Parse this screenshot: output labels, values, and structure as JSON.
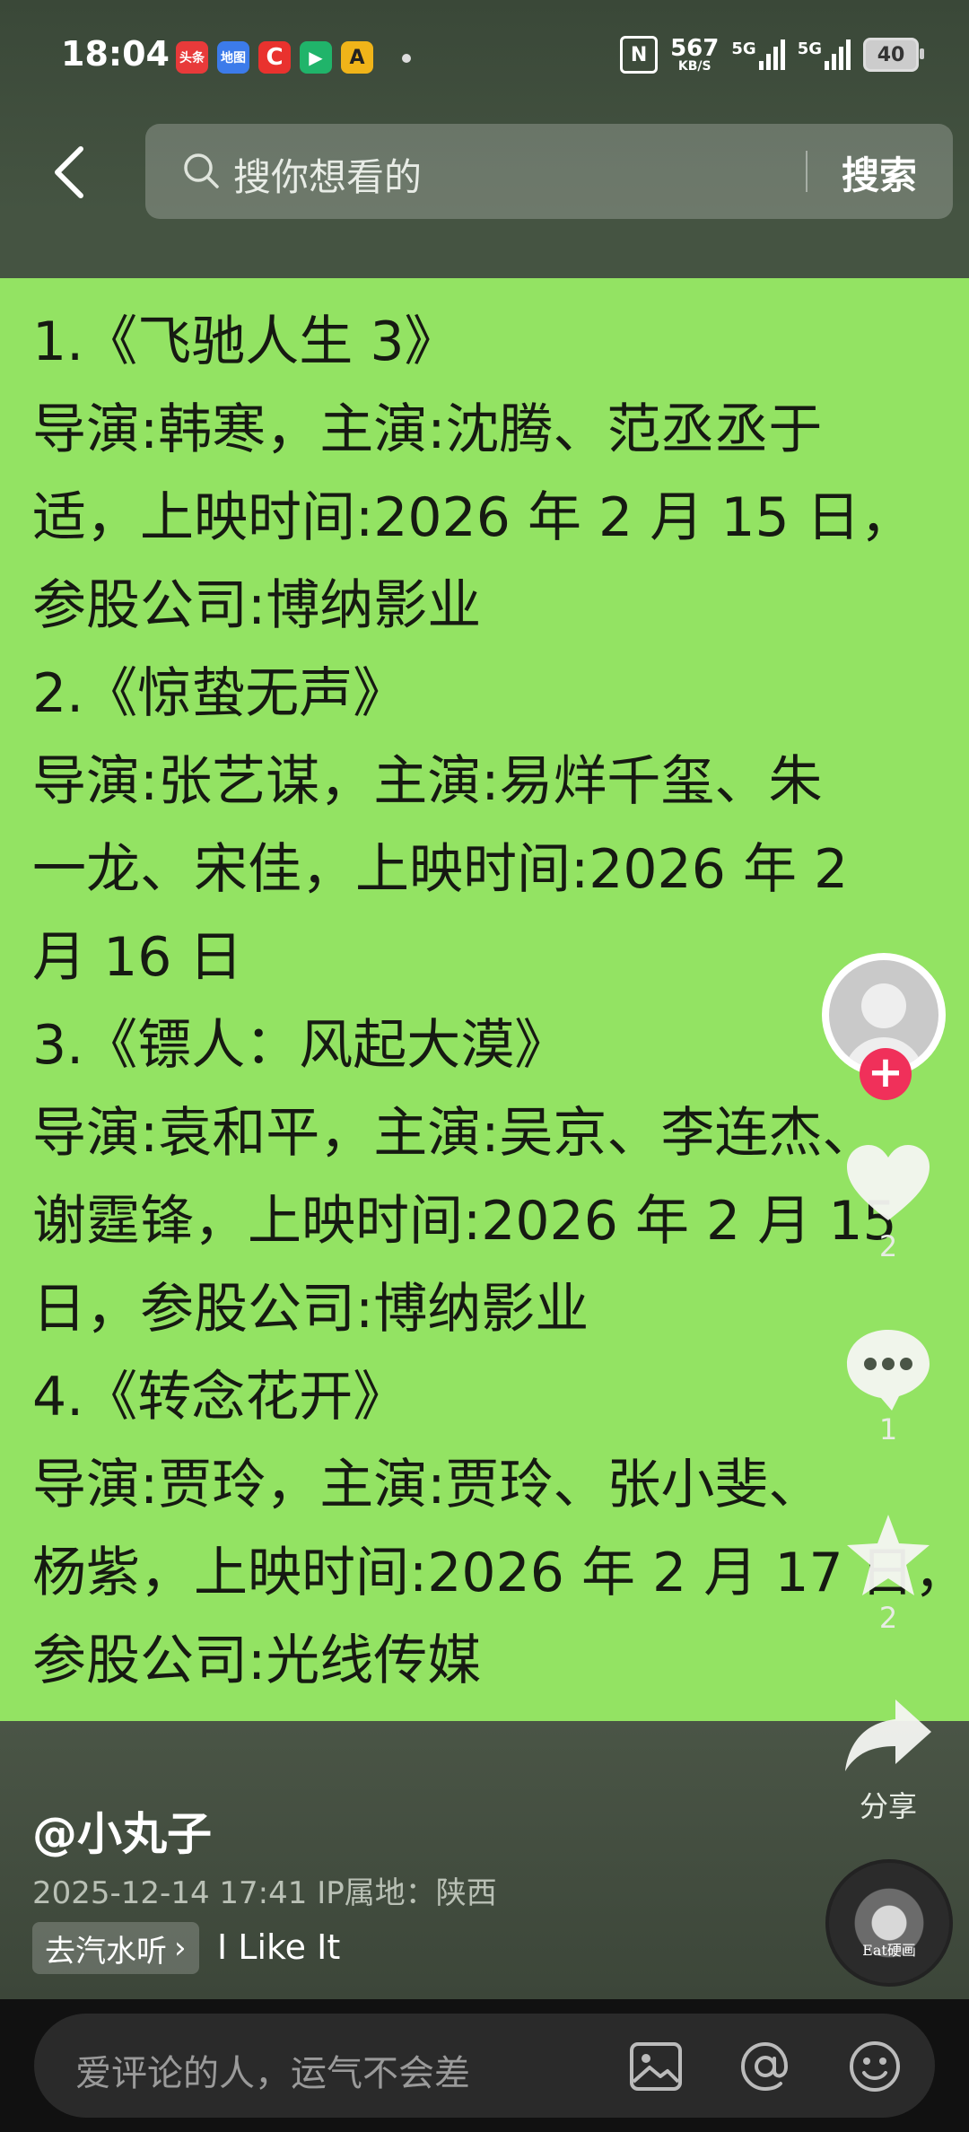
{
  "status_bar": {
    "time": "18:04",
    "apps": [
      {
        "name": "toutiao",
        "label": "头条",
        "color": "#e83a3a"
      },
      {
        "name": "map",
        "label": "地图",
        "color": "#3c7bea"
      },
      {
        "name": "c-app",
        "label": "C",
        "color": "#e9322e"
      },
      {
        "name": "video",
        "label": "▶",
        "color": "#20b46a"
      },
      {
        "name": "wallet",
        "label": "A",
        "color": "#f0b419"
      }
    ],
    "net_speed_value": "567",
    "net_speed_unit": "KB/S",
    "sim1": "5G",
    "sim2": "5G",
    "battery": "40"
  },
  "header": {
    "search_placeholder": "搜你想看的",
    "search_button": "搜索"
  },
  "post": {
    "lines": [
      "1.《飞驰人生 3》",
      "导演:韩寒，主演:沈腾、范丞丞于",
      "适，上映时间:2026 年 2 月 15 日，",
      "参股公司:博纳影业",
      "2.《惊蛰无声》",
      "导演:张艺谋，主演:易烊千玺、朱",
      "一龙、宋佳，上映时间:2026 年 2",
      "月 16 日",
      "3.《镖人：风起大漠》",
      "导演:袁和平，主演:吴京、李连杰、",
      "谢霆锋，上映时间:2026 年 2 月 15",
      "日，参股公司:博纳影业",
      "4.《转念花开》",
      "导演:贾玲，主演:贾玲、张小斐、",
      "杨紫，上映时间:2026 年 2 月 17 日，",
      "参股公司:光线传媒"
    ]
  },
  "actions": {
    "likes": "2",
    "comments": "1",
    "favorites": "2",
    "share_label": "分享"
  },
  "info": {
    "author": "@小丸子",
    "meta": "2025-12-14 17:41  IP属地：陕西",
    "music_tag": "去汽水听",
    "music_title": "I Like It",
    "disc_caption": "Eat硬画"
  },
  "comment_bar": {
    "placeholder": "爱评论的人，运气不会差"
  }
}
